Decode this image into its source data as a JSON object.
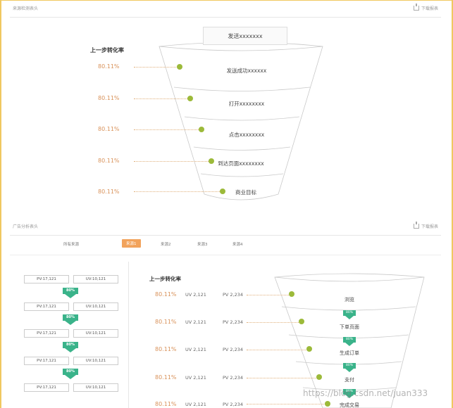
{
  "top_panel": {
    "title": "来源检测表头",
    "download": "下载报表",
    "header_label": "上一步转化率",
    "send_box": "发送xxxxxxx",
    "rates": [
      "80.11%",
      "80.11%",
      "80.11%",
      "80.11%",
      "80.11%"
    ],
    "stages": [
      "发送成功xxxxxx",
      "打开xxxxxxxx",
      "点击xxxxxxxx",
      "到达页面xxxxxxxx",
      "商业目标"
    ]
  },
  "bottom_panel": {
    "title": "广告分析表头",
    "download": "下载报表",
    "tabs": [
      {
        "label": "所有来源",
        "active": false
      },
      {
        "label": "来源1",
        "active": true
      },
      {
        "label": "来源2",
        "active": false
      },
      {
        "label": "来源3",
        "active": false
      },
      {
        "label": "来源4",
        "active": false
      }
    ],
    "pv_uv_rows": [
      {
        "pv": "PV:17,121",
        "uv": "UV:10,121",
        "pct": "80%"
      },
      {
        "pv": "PV:17,121",
        "uv": "UV:10,121",
        "pct": "80%"
      },
      {
        "pv": "PV:17,121",
        "uv": "UV:10,121",
        "pct": "80%"
      },
      {
        "pv": "PV:17,121",
        "uv": "UV:10,121",
        "pct": "80%"
      },
      {
        "pv": "PV:17,121",
        "uv": "UV:10,121",
        "pct": ""
      }
    ],
    "header_label": "上一步转化率",
    "rows": [
      {
        "rate": "80.11%",
        "uv": "UV 2,121",
        "pv": "PV 2,234",
        "stage": "浏览",
        "pct": "80%"
      },
      {
        "rate": "80.11%",
        "uv": "UV 2,121",
        "pv": "PV 2,234",
        "stage": "下单页面",
        "pct": "80%"
      },
      {
        "rate": "80.11%",
        "uv": "UV 2,121",
        "pv": "PV 2,234",
        "stage": "生成订单",
        "pct": "80%"
      },
      {
        "rate": "80.11%",
        "uv": "UV 2,121",
        "pv": "PV 2,234",
        "stage": "支付",
        "pct": "80%"
      },
      {
        "rate": "80.11%",
        "uv": "UV 2,121",
        "pv": "PV 2,234",
        "stage": "完成交易",
        "pct": ""
      }
    ]
  },
  "watermark": "https://blog.csdn.net/juan333",
  "colors": {
    "accent": "#f2a35c",
    "rate": "#d9925a",
    "dot": "#9cba3a",
    "arrow": "#3ab38a"
  }
}
